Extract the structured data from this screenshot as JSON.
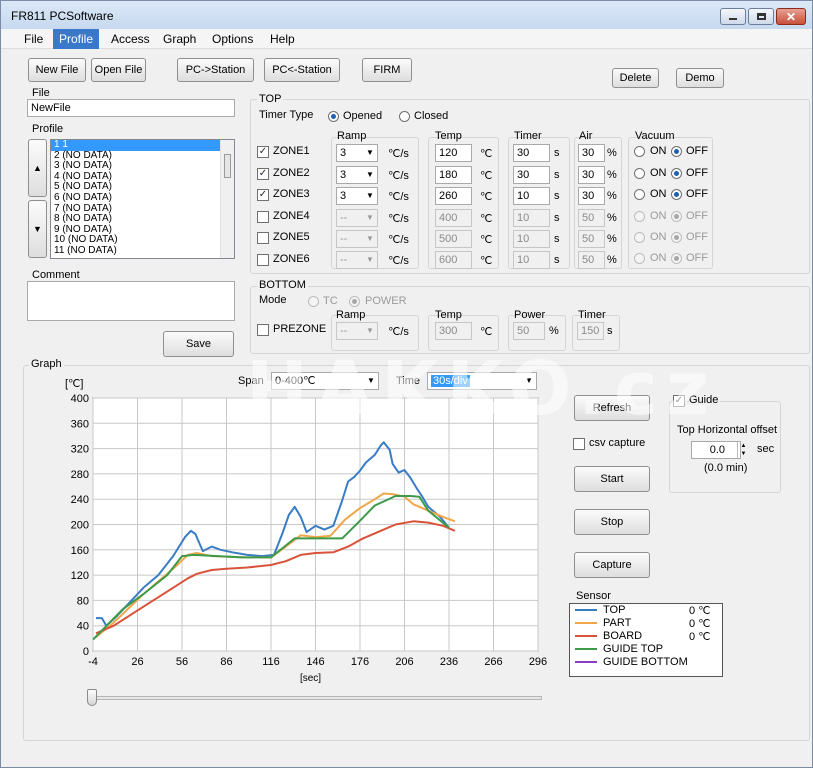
{
  "window": {
    "title": "FR811 PCSoftware"
  },
  "menu": [
    "File",
    "Profile",
    "Access",
    "Graph",
    "Options",
    "Help"
  ],
  "toolbar": {
    "new_file": "New File",
    "open_file": "Open File",
    "pc_to_station": "PC->Station",
    "station_to_pc": "PC<-Station",
    "firm": "FIRM",
    "delete": "Delete",
    "demo": "Demo"
  },
  "file": {
    "label": "File",
    "value": "NewFile"
  },
  "profile": {
    "label": "Profile",
    "items": [
      "1 1",
      "2 (NO DATA)",
      "3 (NO DATA)",
      "4 (NO DATA)",
      "5 (NO DATA)",
      "6 (NO DATA)",
      "7 (NO DATA)",
      "8 (NO DATA)",
      "9 (NO DATA)",
      "10 (NO DATA)",
      "11 (NO DATA)"
    ],
    "up_arrow": "▲",
    "down_arrow": "▼"
  },
  "comment": {
    "label": "Comment",
    "value": ""
  },
  "save_label": "Save",
  "top": {
    "title": "TOP",
    "timer_type_label": "Timer Type",
    "opened_label": "Opened",
    "closed_label": "Closed",
    "headers": {
      "ramp": "Ramp",
      "temp": "Temp",
      "timer": "Timer",
      "air": "Air",
      "vacuum": "Vacuum"
    },
    "units": {
      "ramp": "℃/s",
      "temp": "℃",
      "timer": "s",
      "air": "%"
    },
    "on_label": "ON",
    "off_label": "OFF",
    "zones": [
      {
        "name": "ZONE1",
        "checked": true,
        "ramp": "3",
        "temp": "120",
        "timer": "30",
        "air": "30",
        "vacuum": "OFF"
      },
      {
        "name": "ZONE2",
        "checked": true,
        "ramp": "3",
        "temp": "180",
        "timer": "30",
        "air": "30",
        "vacuum": "OFF"
      },
      {
        "name": "ZONE3",
        "checked": true,
        "ramp": "3",
        "temp": "260",
        "timer": "10",
        "air": "30",
        "vacuum": "OFF"
      },
      {
        "name": "ZONE4",
        "checked": false,
        "ramp": "--",
        "temp": "400",
        "timer": "10",
        "air": "50",
        "vacuum": "OFF"
      },
      {
        "name": "ZONE5",
        "checked": false,
        "ramp": "--",
        "temp": "500",
        "timer": "10",
        "air": "50",
        "vacuum": "OFF"
      },
      {
        "name": "ZONE6",
        "checked": false,
        "ramp": "--",
        "temp": "600",
        "timer": "10",
        "air": "50",
        "vacuum": "OFF"
      }
    ]
  },
  "bottom": {
    "title": "BOTTOM",
    "mode_label": "Mode",
    "tc_label": "TC",
    "power_label": "POWER",
    "prezone_label": "PREZONE",
    "headers": {
      "ramp": "Ramp",
      "temp": "Temp",
      "power": "Power",
      "timer": "Timer"
    },
    "units": {
      "ramp": "℃/s",
      "temp": "℃",
      "power": "%",
      "timer": "s"
    },
    "ramp": "--",
    "temp": "300",
    "power": "50",
    "timer": "150"
  },
  "graph": {
    "label": "Graph",
    "span_label": "Span",
    "span_value": "0-400℃",
    "time_label": "Time",
    "time_value": "30s/div",
    "y_unit": "[℃]",
    "x_unit": "[sec]",
    "refresh": "Refresh",
    "csv_capture": "csv capture",
    "start": "Start",
    "stop": "Stop",
    "capture": "Capture",
    "guide_label": "Guide",
    "top_offset_label": "Top Horizontal offset",
    "offset_value": "0.0",
    "offset_unit": "sec",
    "offset_min": "(0.0 min)",
    "sensor_label": "Sensor"
  },
  "sensor_legend": [
    {
      "name": "TOP",
      "value": "0 ℃",
      "color": "#3a7cc4"
    },
    {
      "name": "PART",
      "value": "0 ℃",
      "color": "#f2a64a"
    },
    {
      "name": "BOARD",
      "value": "0 ℃",
      "color": "#d9523a"
    },
    {
      "name": "GUIDE TOP",
      "value": "",
      "color": "#3c9a4a"
    },
    {
      "name": "GUIDE BOTTOM",
      "value": "",
      "color": "#8a3cc4"
    }
  ],
  "watermark": "HAKKO.cz",
  "chart_data": {
    "type": "line",
    "xlabel": "[sec]",
    "ylabel": "[℃]",
    "xlim": [
      -4,
      296
    ],
    "ylim": [
      0,
      400
    ],
    "xticks": [
      "-4",
      "26",
      "56",
      "86",
      "116",
      "146",
      "176",
      "206",
      "236",
      "266",
      "296"
    ],
    "yticks": [
      "0",
      "40",
      "80",
      "120",
      "160",
      "200",
      "240",
      "280",
      "320",
      "360",
      "400"
    ],
    "grid": true,
    "series": [
      {
        "name": "TOP",
        "color": "#3a7cc4",
        "points": [
          [
            -2,
            52
          ],
          [
            2,
            52
          ],
          [
            5,
            40
          ],
          [
            12,
            55
          ],
          [
            20,
            75
          ],
          [
            30,
            100
          ],
          [
            40,
            120
          ],
          [
            50,
            150
          ],
          [
            58,
            180
          ],
          [
            62,
            190
          ],
          [
            65,
            185
          ],
          [
            70,
            158
          ],
          [
            76,
            165
          ],
          [
            82,
            160
          ],
          [
            90,
            156
          ],
          [
            100,
            152
          ],
          [
            110,
            150
          ],
          [
            118,
            152
          ],
          [
            124,
            188
          ],
          [
            128,
            215
          ],
          [
            132,
            228
          ],
          [
            136,
            212
          ],
          [
            140,
            188
          ],
          [
            146,
            198
          ],
          [
            152,
            192
          ],
          [
            158,
            198
          ],
          [
            164,
            238
          ],
          [
            168,
            268
          ],
          [
            172,
            275
          ],
          [
            176,
            285
          ],
          [
            180,
            298
          ],
          [
            186,
            310
          ],
          [
            190,
            325
          ],
          [
            192,
            330
          ],
          [
            196,
            318
          ],
          [
            198,
            296
          ],
          [
            202,
            282
          ],
          [
            206,
            286
          ],
          [
            210,
            274
          ],
          [
            214,
            258
          ],
          [
            218,
            244
          ],
          [
            222,
            228
          ],
          [
            230,
            212
          ],
          [
            236,
            195
          ]
        ]
      },
      {
        "name": "PART",
        "color": "#f2a64a",
        "points": [
          [
            -2,
            22
          ],
          [
            10,
            45
          ],
          [
            30,
            90
          ],
          [
            50,
            130
          ],
          [
            60,
            152
          ],
          [
            66,
            155
          ],
          [
            76,
            150
          ],
          [
            100,
            148
          ],
          [
            116,
            148
          ],
          [
            126,
            165
          ],
          [
            136,
            183
          ],
          [
            146,
            180
          ],
          [
            156,
            182
          ],
          [
            166,
            208
          ],
          [
            176,
            226
          ],
          [
            186,
            240
          ],
          [
            192,
            249
          ],
          [
            198,
            248
          ],
          [
            206,
            244
          ],
          [
            212,
            232
          ],
          [
            222,
            222
          ],
          [
            232,
            212
          ],
          [
            240,
            205
          ]
        ]
      },
      {
        "name": "BOARD",
        "color": "#d9523a",
        "points": [
          [
            -2,
            28
          ],
          [
            10,
            40
          ],
          [
            30,
            70
          ],
          [
            50,
            100
          ],
          [
            60,
            115
          ],
          [
            66,
            122
          ],
          [
            76,
            128
          ],
          [
            86,
            130
          ],
          [
            100,
            132
          ],
          [
            116,
            136
          ],
          [
            126,
            142
          ],
          [
            136,
            152
          ],
          [
            146,
            155
          ],
          [
            158,
            156
          ],
          [
            168,
            165
          ],
          [
            178,
            178
          ],
          [
            190,
            190
          ],
          [
            200,
            200
          ],
          [
            212,
            205
          ],
          [
            222,
            203
          ],
          [
            232,
            198
          ],
          [
            240,
            190
          ]
        ]
      },
      {
        "name": "GUIDE TOP",
        "color": "#3c9a4a",
        "points": [
          [
            -4,
            18
          ],
          [
            16,
            66
          ],
          [
            30,
            90
          ],
          [
            46,
            120
          ],
          [
            56,
            150
          ],
          [
            64,
            152
          ],
          [
            96,
            148
          ],
          [
            116,
            148
          ],
          [
            132,
            178
          ],
          [
            150,
            178
          ],
          [
            164,
            178
          ],
          [
            176,
            206
          ],
          [
            186,
            230
          ],
          [
            200,
            245
          ],
          [
            210,
            245
          ],
          [
            216,
            244
          ],
          [
            222,
            222
          ],
          [
            236,
            195
          ]
        ]
      }
    ]
  }
}
